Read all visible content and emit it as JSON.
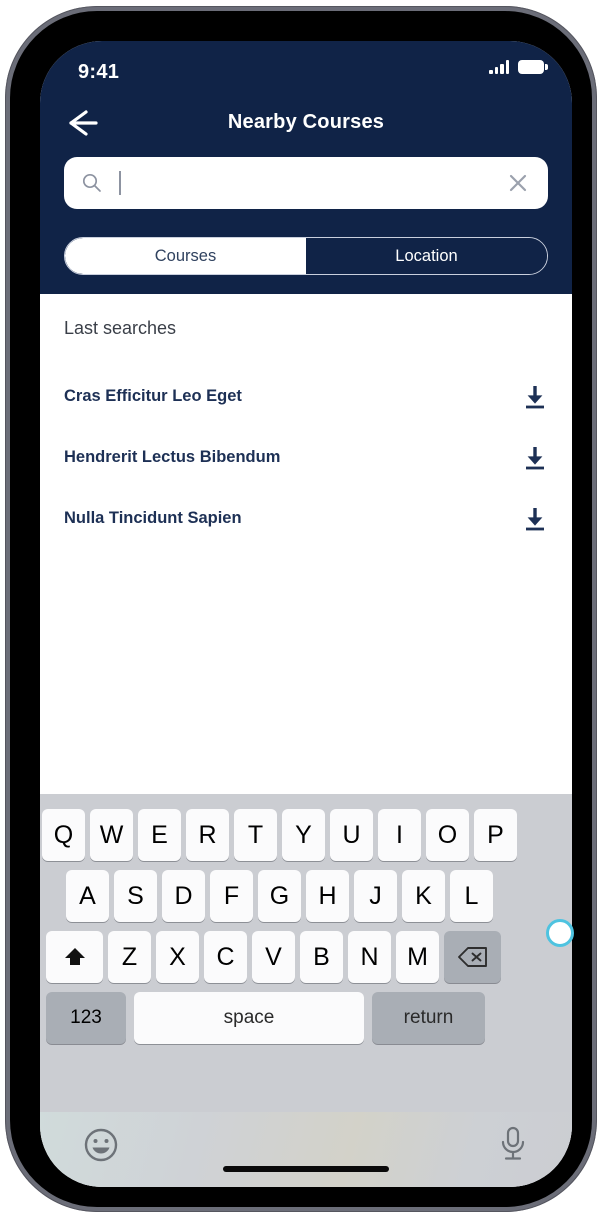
{
  "theme": {
    "navy": "#102347",
    "list_text": "#1d3055",
    "keyboard_bg": "#cbcdd2",
    "key_bg": "#fbfbfc",
    "key_mod_bg": "#a9aeb5",
    "cursor_ring": "#4ec3e0"
  },
  "status_bar": {
    "time": "9:41",
    "signal_icon": "signal-bars-icon",
    "battery_icon": "battery-full-icon"
  },
  "nav_bar": {
    "back_icon": "arrow-left-icon",
    "title": "Nearby Courses"
  },
  "search": {
    "icon": "search-icon",
    "value": "",
    "placeholder": "",
    "clear_icon": "close-x-icon",
    "caret_visible": true
  },
  "segmented_control": {
    "selected": "Courses",
    "segments": [
      {
        "label": "Courses",
        "active": true
      },
      {
        "label": "Location",
        "active": false
      }
    ]
  },
  "content": {
    "section_label": "Last searches",
    "items": [
      {
        "label": "Cras Efficitur Leo Eget",
        "action_icon": "download-icon"
      },
      {
        "label": "Hendrerit Lectus Bibendum",
        "action_icon": "download-icon"
      },
      {
        "label": "Nulla Tincidunt Sapien",
        "action_icon": "download-icon"
      }
    ]
  },
  "keyboard": {
    "row1": [
      "Q",
      "W",
      "E",
      "R",
      "T",
      "Y",
      "U",
      "I",
      "O",
      "P"
    ],
    "row2": [
      "A",
      "S",
      "D",
      "F",
      "G",
      "H",
      "J",
      "K",
      "L"
    ],
    "row3": [
      "Z",
      "X",
      "C",
      "V",
      "B",
      "N",
      "M"
    ],
    "shift_icon": "shift-up-arrow-icon",
    "backspace_icon": "backspace-delete-icon",
    "numeric_label": "123",
    "space_label": "space",
    "return_label": "return",
    "emoji_icon": "emoji-smiley-icon",
    "mic_icon": "microphone-icon"
  }
}
